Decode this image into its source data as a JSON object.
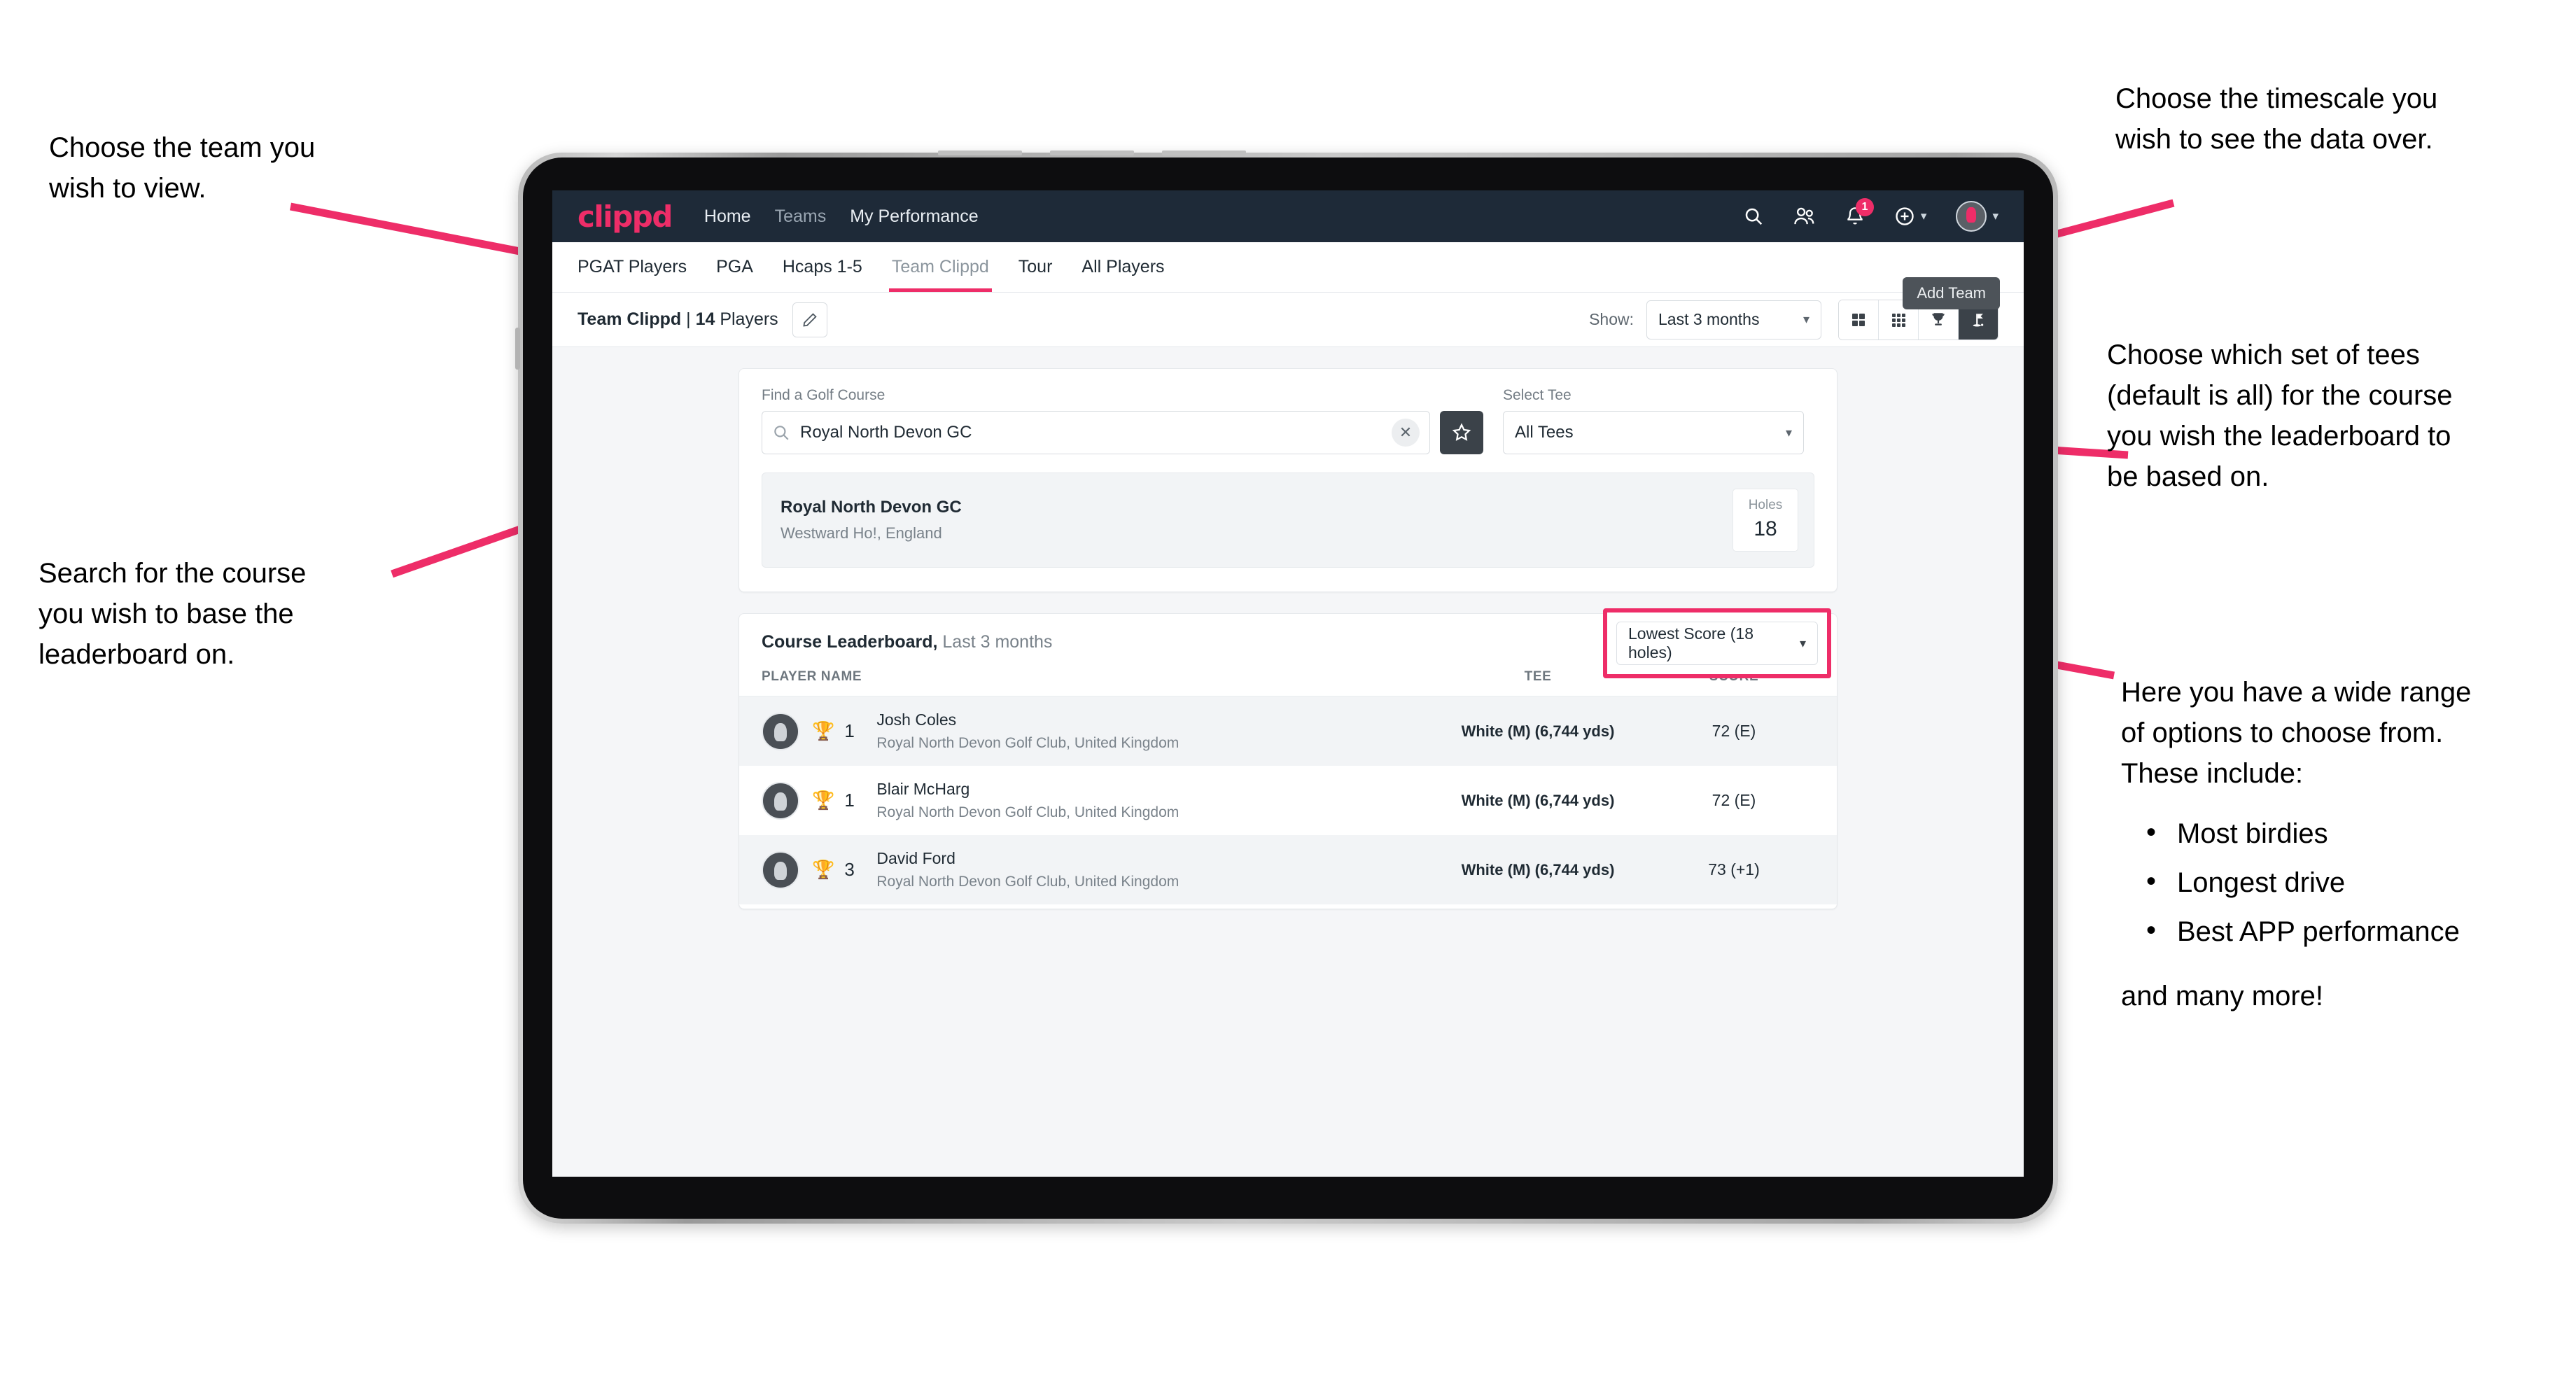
{
  "annotations": {
    "left_top": "Choose the team you\nwish to view.",
    "left_mid": "Search for the course\nyou wish to base the\nleaderboard on.",
    "right_top": "Choose the timescale you\nwish to see the data over.",
    "right_tees": "Choose which set of tees\n(default is all) for the course\nyou wish the leaderboard to\nbe based on.",
    "right_options_intro": "Here you have a wide range\nof options to choose from.\nThese include:",
    "right_options_bullets": [
      "Most birdies",
      "Longest drive",
      "Best APP performance"
    ],
    "right_options_tail": "and many more!"
  },
  "navbar": {
    "logo": "clippd",
    "links": [
      {
        "label": "Home",
        "active": true
      },
      {
        "label": "Teams",
        "active": false
      },
      {
        "label": "My Performance",
        "active": true
      }
    ],
    "icons": [
      "search-icon",
      "people-icon",
      "bell-icon",
      "plus-circle-icon",
      "avatar-icon"
    ],
    "notification_count": "1"
  },
  "tabs": {
    "items": [
      {
        "label": "PGAT Players",
        "active": false
      },
      {
        "label": "PGA",
        "active": false
      },
      {
        "label": "Hcaps 1-5",
        "active": false
      },
      {
        "label": "Team Clippd",
        "active": true
      },
      {
        "label": "Tour",
        "active": false
      },
      {
        "label": "All Players",
        "active": false
      }
    ],
    "tooltip": "Add Team"
  },
  "toolbar": {
    "team_name": "Team Clippd",
    "separator": " | ",
    "player_count": "14",
    "players_word": " Players",
    "edit_icon": "pencil-icon",
    "show_label": "Show:",
    "show_value": "Last 3 months",
    "view_modes": [
      {
        "name": "grid-4-icon",
        "active": false
      },
      {
        "name": "grid-9-icon",
        "active": false
      },
      {
        "name": "trophy-icon",
        "active": false
      },
      {
        "name": "golf-flag-icon",
        "active": true
      }
    ]
  },
  "search": {
    "course_label": "Find a Golf Course",
    "course_value": "Royal North Devon GC",
    "course_placeholder": "Find a Golf Course",
    "clear_icon": "close-icon",
    "star_icon": "star-icon",
    "tee_label": "Select Tee",
    "tee_value": "All Tees"
  },
  "course_result": {
    "name": "Royal North Devon GC",
    "location": "Westward Ho!, England",
    "holes_label": "Holes",
    "holes_value": "18"
  },
  "leaderboard": {
    "title": "Course Leaderboard,",
    "subtitle": " Last 3 months",
    "sort_value": "Lowest Score (18 holes)",
    "columns": [
      "PLAYER NAME",
      "TEE",
      "SCORE"
    ],
    "rows": [
      {
        "rank": "1",
        "name": "Josh Coles",
        "club": "Royal North Devon Golf Club, United Kingdom",
        "tee": "White (M) (6,744 yds)",
        "score": "72 (E)"
      },
      {
        "rank": "1",
        "name": "Blair McHarg",
        "club": "Royal North Devon Golf Club, United Kingdom",
        "tee": "White (M) (6,744 yds)",
        "score": "72 (E)"
      },
      {
        "rank": "3",
        "name": "David Ford",
        "club": "Royal North Devon Golf Club, United Kingdom",
        "tee": "White (M) (6,744 yds)",
        "score": "73 (+1)"
      }
    ]
  },
  "colors": {
    "accent_pink": "#ee2d68",
    "navbar_dark": "#1e2a38",
    "active_toggle": "#3b4249",
    "page_bg": "#f5f6f8"
  }
}
